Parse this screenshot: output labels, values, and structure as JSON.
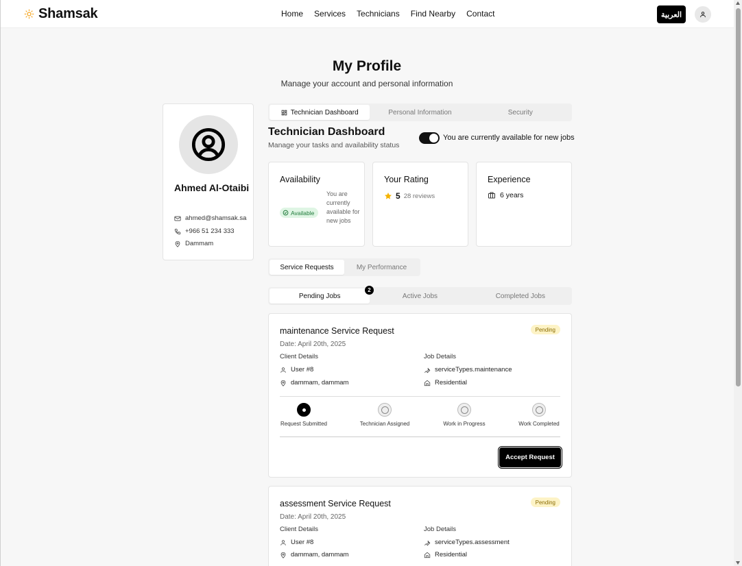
{
  "header": {
    "brand": "Shamsak",
    "nav": [
      "Home",
      "Services",
      "Technicians",
      "Find Nearby",
      "Contact"
    ],
    "lang_button": "العربية"
  },
  "page": {
    "title": "My Profile",
    "subtitle": "Manage your account and personal information"
  },
  "profile": {
    "name": "Ahmed Al-Otaibi",
    "email": "ahmed@shamsak.sa",
    "phone": "+966 51 234 333",
    "location": "Dammam"
  },
  "profile_tabs": [
    "Technician Dashboard",
    "Personal Information",
    "Security"
  ],
  "dashboard": {
    "title": "Technician Dashboard",
    "subtitle": "Manage your tasks and availability status",
    "toggle_label": "You are currently available for new jobs",
    "toggle_on": true
  },
  "stats": {
    "availability": {
      "title": "Availability",
      "badge": "Available",
      "text": "You are currently available for new jobs"
    },
    "rating": {
      "title": "Your Rating",
      "value": "5",
      "reviews": "28 reviews"
    },
    "experience": {
      "title": "Experience",
      "value": "6 years"
    }
  },
  "section_tabs": [
    "Service Requests",
    "My Performance"
  ],
  "job_tabs": [
    "Pending Jobs",
    "Active Jobs",
    "Completed Jobs"
  ],
  "pending_count": "2",
  "requests": [
    {
      "title": "maintenance Service Request",
      "status": "Pending",
      "date": "Date: April 20th, 2025",
      "client_heading": "Client Details",
      "job_heading": "Job Details",
      "user": "User #8",
      "address": "dammam, dammam",
      "service_type": "serviceTypes.maintenance",
      "property": "Residential",
      "steps": [
        "Request Submitted",
        "Technician Assigned",
        "Work in Progress",
        "Work Completed"
      ],
      "accept_label": "Accept Request"
    },
    {
      "title": "assessment Service Request",
      "status": "Pending",
      "date": "Date: April 20th, 2025",
      "client_heading": "Client Details",
      "job_heading": "Job Details",
      "user": "User #8",
      "address": "dammam, dammam",
      "service_type": "serviceTypes.assessment",
      "property": "Residential"
    }
  ],
  "colors": {
    "accent": "#f5a623",
    "primary": "#000000",
    "available_bg": "#dff5e4",
    "pending_bg": "#fdf3c6"
  }
}
